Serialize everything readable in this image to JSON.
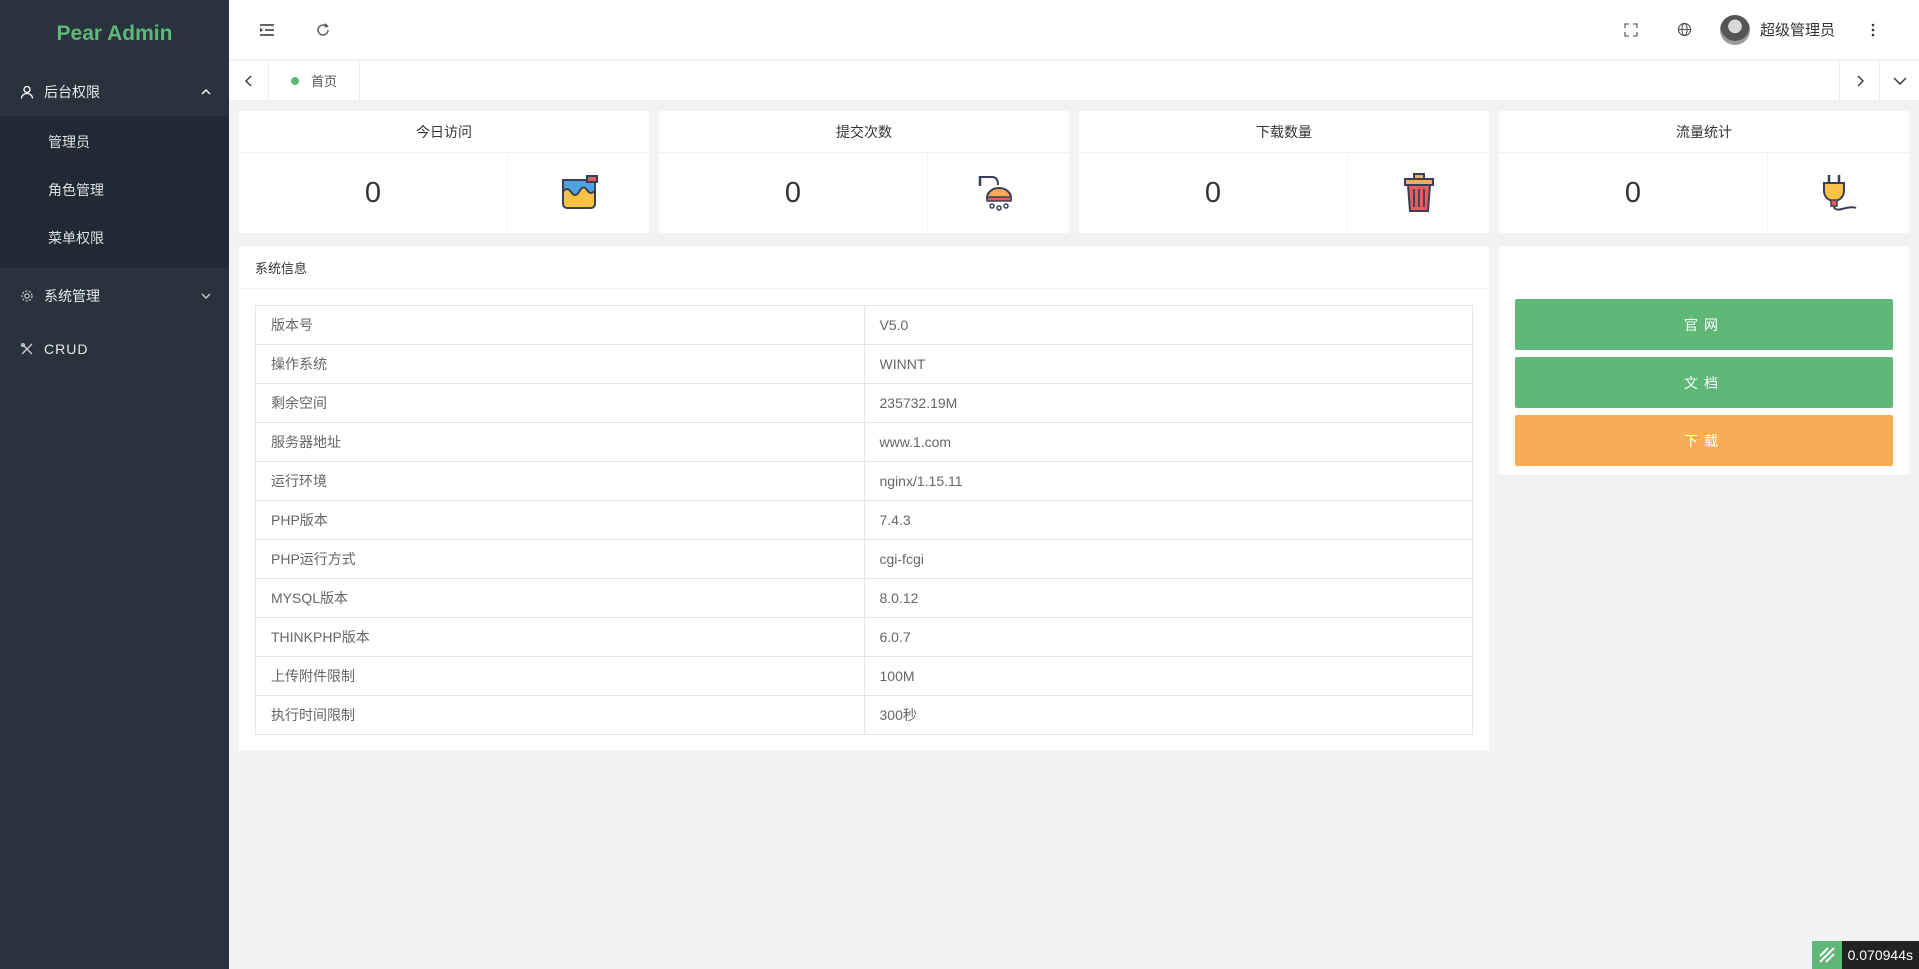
{
  "sidebar": {
    "logo": "Pear Admin",
    "groups": [
      {
        "label": "后台权限",
        "icon": "user-icon",
        "open": true,
        "items": [
          {
            "label": "管理员"
          },
          {
            "label": "角色管理"
          },
          {
            "label": "菜单权限"
          }
        ]
      },
      {
        "label": "系统管理",
        "icon": "gear-icon",
        "open": false
      },
      {
        "label": "CRUD",
        "icon": "tools-icon",
        "open": false
      }
    ]
  },
  "header": {
    "user_name": "超级管理员"
  },
  "tabs": [
    {
      "label": "首页",
      "active": true
    }
  ],
  "stats": [
    {
      "title": "今日访问",
      "value": "0",
      "icon": "paint-bucket-icon"
    },
    {
      "title": "提交次数",
      "value": "0",
      "icon": "shower-icon"
    },
    {
      "title": "下载数量",
      "value": "0",
      "icon": "trash-bin-icon"
    },
    {
      "title": "流量统计",
      "value": "0",
      "icon": "plug-icon"
    }
  ],
  "system_info": {
    "title": "系统信息",
    "rows": [
      {
        "key": "版本号",
        "value": "V5.0"
      },
      {
        "key": "操作系统",
        "value": "WINNT"
      },
      {
        "key": "剩余空间",
        "value": "235732.19M"
      },
      {
        "key": "服务器地址",
        "value": "www.1.com"
      },
      {
        "key": "运行环境",
        "value": "nginx/1.15.11"
      },
      {
        "key": "PHP版本",
        "value": "7.4.3"
      },
      {
        "key": "PHP运行方式",
        "value": "cgi-fcgi"
      },
      {
        "key": "MYSQL版本",
        "value": "8.0.12"
      },
      {
        "key": "THINKPHP版本",
        "value": "6.0.7"
      },
      {
        "key": "上传附件限制",
        "value": "100M"
      },
      {
        "key": "执行时间限制",
        "value": "300秒"
      }
    ]
  },
  "links": {
    "website": "官网",
    "docs": "文档",
    "download": "下载"
  },
  "timer": "0.070944s",
  "colors": {
    "sidebar_bg": "#28333e",
    "submenu_bg": "#1f2a34",
    "brand_green": "#5fb878",
    "download_orange": "#f6ad55"
  }
}
